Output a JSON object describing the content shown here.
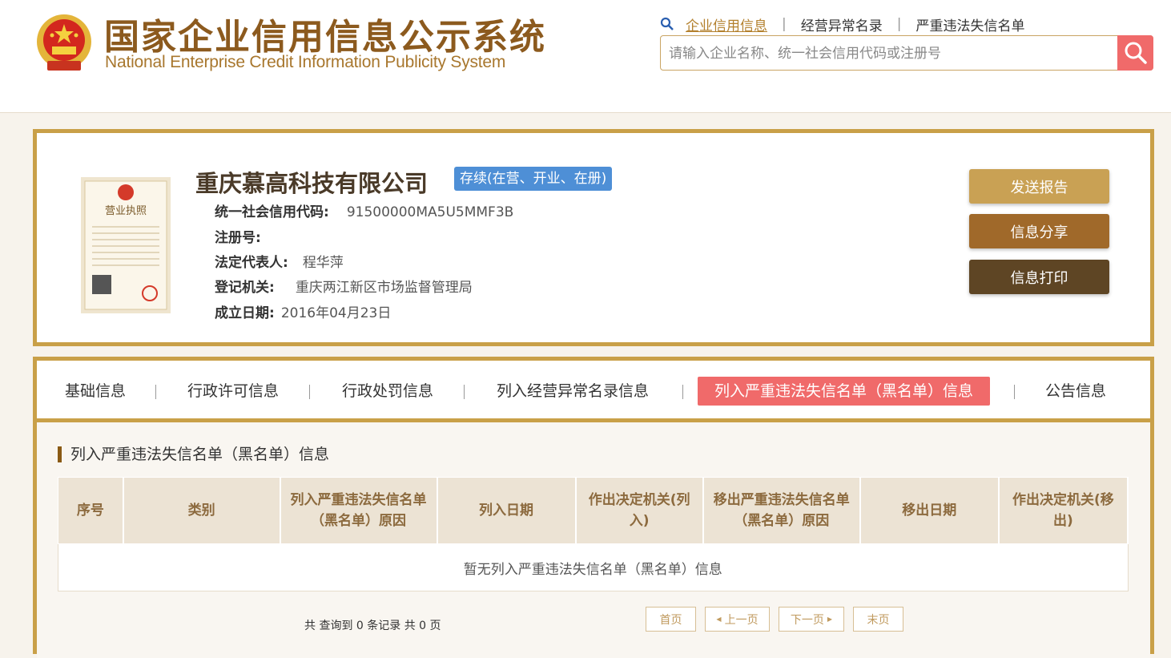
{
  "header": {
    "title_cn": "国家企业信用信息公示系统",
    "title_en": "National Enterprise Credit Information Publicity System",
    "nav": [
      {
        "label": "企业信用信息",
        "active": true
      },
      {
        "label": "经营异常名录"
      },
      {
        "label": "严重违法失信名单"
      }
    ],
    "search": {
      "placeholder": "请输入企业名称、统一社会信用代码或注册号",
      "value": ""
    }
  },
  "company": {
    "name": "重庆慕高科技有限公司",
    "status": "存续(在营、开业、在册)",
    "fields": [
      {
        "label": "统一社会信用代码:",
        "value": "91500000MA5U5MMF3B"
      },
      {
        "label": "注册号:",
        "value": ""
      },
      {
        "label": "法定代表人:",
        "value": "程华萍"
      },
      {
        "label": "登记机关:",
        "value": "重庆两江新区市场监督管理局"
      },
      {
        "label": "成立日期:",
        "value": "2016年04月23日"
      }
    ],
    "license_title": "营业执照",
    "actions": [
      {
        "label": "发送报告",
        "color": "#c9a154"
      },
      {
        "label": "信息分享",
        "color": "#a0692a"
      },
      {
        "label": "信息打印",
        "color": "#5e4524"
      }
    ]
  },
  "tabs": [
    {
      "label": "基础信息"
    },
    {
      "label": "行政许可信息"
    },
    {
      "label": "行政处罚信息"
    },
    {
      "label": "列入经营异常名录信息"
    },
    {
      "label": "列入严重违法失信名单（黑名单）信息",
      "active": true
    },
    {
      "label": "公告信息"
    }
  ],
  "section": {
    "title": "列入严重违法失信名单（黑名单）信息",
    "columns": [
      "序号",
      "类别",
      "列入严重违法失信名单（黑名单）原因",
      "列入日期",
      "作出决定机关(列入)",
      "移出严重违法失信名单（黑名单）原因",
      "移出日期",
      "作出决定机关(移出)"
    ],
    "empty_message": "暂无列入严重违法失信名单（黑名单）信息",
    "summary": "共 查询到 0 条记录 共 0 页",
    "pagination": {
      "first": "首页",
      "prev": "上一页",
      "next": "下一页",
      "last": "末页"
    }
  },
  "colors": {
    "accent": "#c9a048",
    "active_tab": "#f06a6a",
    "status": "#4e8fd6",
    "brand": "#8c5a1e"
  }
}
